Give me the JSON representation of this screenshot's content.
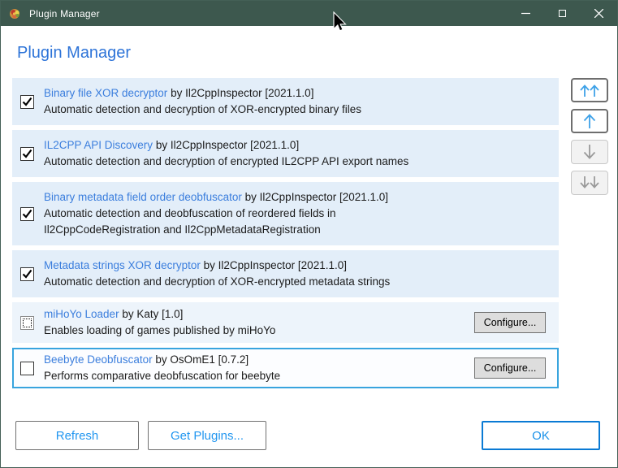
{
  "window": {
    "title": "Plugin Manager",
    "icon": "plugin-flower-icon",
    "controls": {
      "minimize": "—",
      "close": "✕"
    }
  },
  "header": {
    "title": "Plugin Manager"
  },
  "accent_colors": {
    "titlebar": "#3d584e",
    "heading_blue": "#2e74d8",
    "link_blue": "#3b7edd",
    "row_background": "#e3eef9",
    "selected_border": "#38a4de",
    "button_blue": "#2196f0"
  },
  "configure_label": "Configure...",
  "plugins": [
    {
      "name": "Binary file XOR decryptor",
      "byline": "by Il2CppInspector [2021.1.0]",
      "description": "Automatic detection and decryption of XOR-encrypted binary files",
      "checkbox": "checked",
      "selected": false
    },
    {
      "name": "IL2CPP API Discovery",
      "byline": "by Il2CppInspector [2021.1.0]",
      "description": "Automatic detection and decryption of encrypted IL2CPP API export names",
      "checkbox": "checked",
      "selected": false
    },
    {
      "name": "Binary metadata field order deobfuscator",
      "byline": "by Il2CppInspector [2021.1.0]",
      "description": "Automatic detection and deobfuscation of reordered fields in\nIl2CppCodeRegistration and Il2CppMetadataRegistration",
      "checkbox": "checked",
      "selected": false
    },
    {
      "name": "Metadata strings XOR decryptor",
      "byline": "by Il2CppInspector [2021.1.0]",
      "description": "Automatic detection and decryption of XOR-encrypted metadata strings",
      "checkbox": "checked",
      "selected": false
    },
    {
      "name": "miHoYo Loader",
      "byline": "by Katy [1.0]",
      "description": "Enables loading of games published by miHoYo",
      "checkbox": "indeterminate",
      "selected": false
    },
    {
      "name": "Beebyte Deobfuscator",
      "byline": "by OsOmE1 [0.7.2]",
      "description": "Performs comparative deobfuscation for beebyte",
      "checkbox": "unchecked",
      "selected": true
    }
  ],
  "reorder": {
    "move_top": {
      "icon": "double-up-arrow-icon",
      "enabled": true
    },
    "move_up": {
      "icon": "up-arrow-icon",
      "enabled": true
    },
    "move_down": {
      "icon": "down-arrow-icon",
      "enabled": false
    },
    "move_bottom": {
      "icon": "double-down-arrow-icon",
      "enabled": false
    }
  },
  "footer": {
    "refresh": "Refresh",
    "get_plugins": "Get Plugins...",
    "ok": "OK"
  }
}
